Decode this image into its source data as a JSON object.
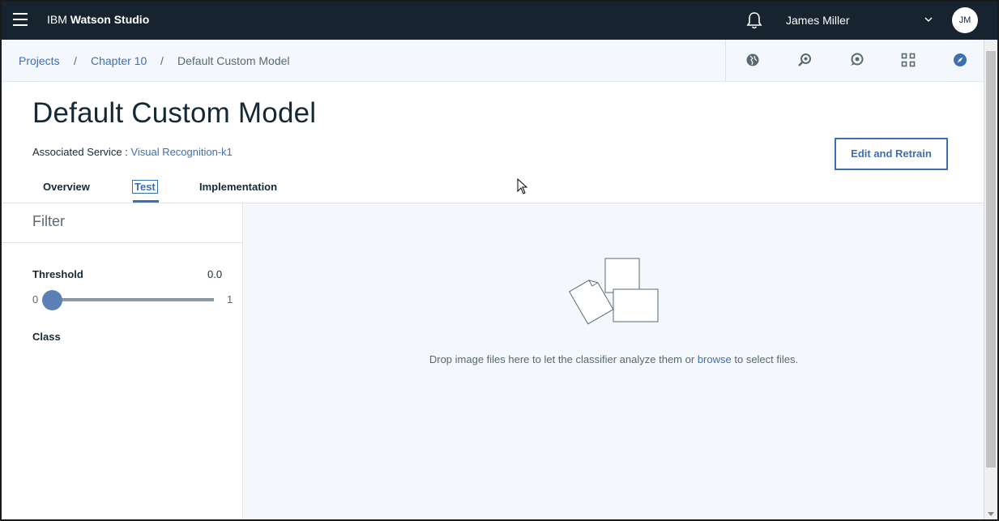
{
  "topbar": {
    "brand_prefix": "IBM",
    "brand_name": "Watson Studio",
    "user_name": "James Miller",
    "avatar_initials": "JM",
    "background": "#172430"
  },
  "breadcrumb": {
    "items": [
      "Projects",
      "Chapter 10",
      "Default Custom Model"
    ],
    "separator": "/"
  },
  "toolbar": {
    "icons": [
      "globe-icon",
      "search-icon",
      "chat-icon",
      "grid-icon",
      "compass-icon"
    ]
  },
  "header": {
    "title": "Default Custom Model",
    "associated_service_label": "Associated Service :",
    "associated_service_value": "Visual Recognition-k1",
    "edit_button_label": "Edit and Retrain"
  },
  "tabs": [
    {
      "label": "Overview",
      "active": false
    },
    {
      "label": "Test",
      "active": true
    },
    {
      "label": "Implementation",
      "active": false
    }
  ],
  "filter": {
    "title": "Filter",
    "threshold_label": "Threshold",
    "threshold_value": "0.0",
    "slider_min": "0",
    "slider_max": "1",
    "slider_level": 0.0,
    "class_label": "Class"
  },
  "dropzone": {
    "text_before": "Drop image files here to let the classifier analyze them or",
    "link_text": "browse",
    "text_after": "to select files."
  },
  "colors": {
    "accent": "#3d70b2",
    "panel_bg": "#f4f7fb"
  }
}
